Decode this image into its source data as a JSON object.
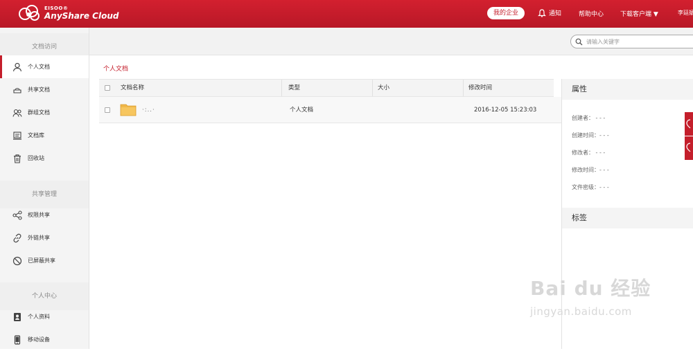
{
  "header": {
    "brand_small": "EISOO®",
    "brand_name": "AnyShare Cloud",
    "my_enterprise": "我的企业",
    "notify": "通知",
    "help": "帮助中心",
    "download": "下载客户端 ▼",
    "user": "李廷斌"
  },
  "sidebar": {
    "section_docs": "文档访问",
    "section_share": "共享管理",
    "section_personal": "个人中心",
    "items": [
      {
        "label": "个人文档"
      },
      {
        "label": "共享文档"
      },
      {
        "label": "群组文档"
      },
      {
        "label": "文档库"
      },
      {
        "label": "回收站"
      },
      {
        "label": "权限共享"
      },
      {
        "label": "外链共享"
      },
      {
        "label": "已屏蔽共享"
      },
      {
        "label": "个人资料"
      },
      {
        "label": "移动设备"
      }
    ]
  },
  "search": {
    "placeholder": "请输入关键字"
  },
  "breadcrumb": "个人文档",
  "table": {
    "columns": [
      "文档名称",
      "类型",
      "大小",
      "修改时间"
    ],
    "rows": [
      {
        "name": "·:..·",
        "type": "个人文档",
        "size": "",
        "modified": "2016-12-05 15:23:03"
      }
    ]
  },
  "properties": {
    "title": "属性",
    "rows": [
      {
        "label": "创建者：",
        "value": "- - -"
      },
      {
        "label": "创建时间：",
        "value": "- - -"
      },
      {
        "label": "修改者：",
        "value": "- - -"
      },
      {
        "label": "修改时间：",
        "value": "- - -"
      },
      {
        "label": "文件密级：",
        "value": "- - -"
      }
    ],
    "tags_title": "标签"
  },
  "watermark": {
    "line1": "Bai du 经验",
    "line2": "jingyan.baidu.com"
  },
  "colors": {
    "brand_red": "#c41e2b",
    "sidebar_bg": "#f4f4f4"
  }
}
